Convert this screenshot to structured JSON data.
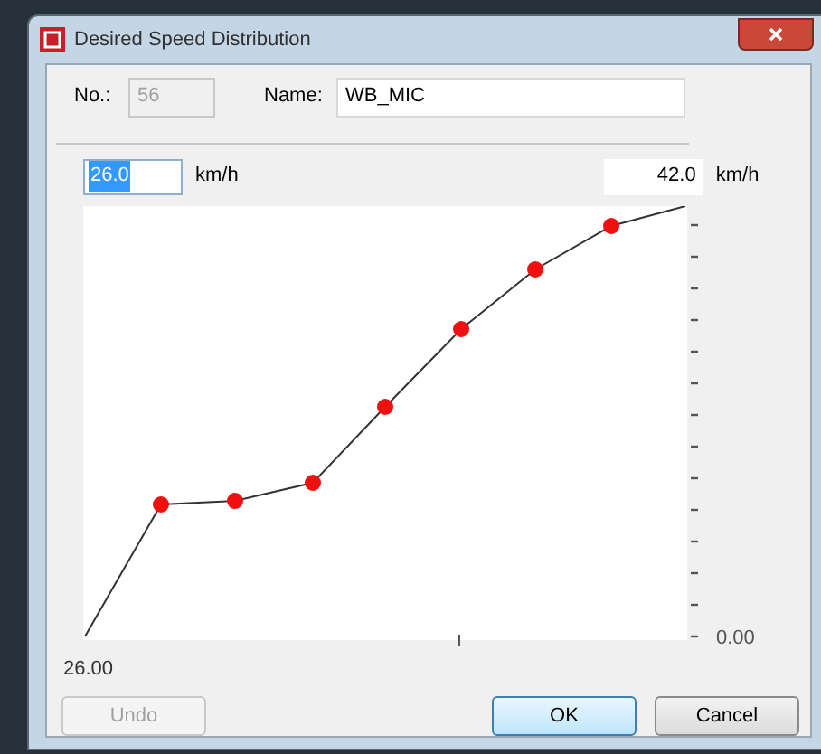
{
  "window": {
    "title": "Desired Speed Distribution"
  },
  "no_field": {
    "label": "No.:",
    "value": "56",
    "disabled": true
  },
  "name_field": {
    "label": "Name:",
    "value": "WB_MIC"
  },
  "range": {
    "from": {
      "value": "26.0",
      "unit": "km/h",
      "text_selected": true
    },
    "to": {
      "value": "42.0",
      "unit": "km/h",
      "text_selected": false
    }
  },
  "chart": {
    "x_label": "26.00",
    "y_label": "0.00"
  },
  "buttons": [
    {
      "label": "Undo",
      "disabled": true,
      "focused": false
    },
    {
      "label": "OK",
      "disabled": false,
      "focused": true
    },
    {
      "label": "Cancel",
      "disabled": false,
      "focused": false
    }
  ]
}
